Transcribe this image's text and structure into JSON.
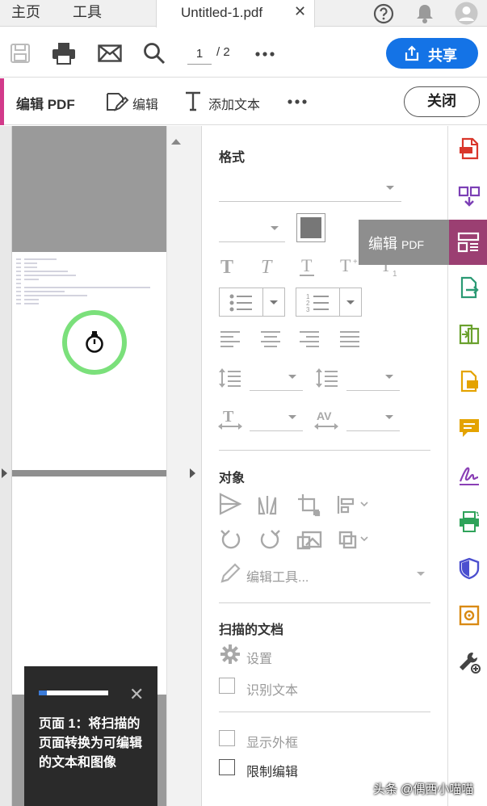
{
  "tabs": {
    "home": "主页",
    "tools": "工具",
    "document": "Untitled-1.pdf",
    "close_symbol": "✕"
  },
  "toolbar": {
    "page_current": "1",
    "page_total": "/ 2",
    "share_label": "共享"
  },
  "edit_bar": {
    "title": "编辑 PDF",
    "edit_label": "编辑",
    "add_text_label": "添加文本",
    "close_label": "关闭"
  },
  "props": {
    "format_title": "格式",
    "object_title": "对象",
    "edit_tools_label": "编辑工具...",
    "scan_title": "扫描的文档",
    "settings_label": "设置",
    "ocr_label": "识别文本",
    "show_bbox_label": "显示外框",
    "restrict_edit_label": "限制编辑",
    "color_swatch": "#777777"
  },
  "tooltip": {
    "main": "编辑",
    "suffix": "PDF"
  },
  "coach": {
    "text": "页面 1：将扫描的页面转换为可编辑的文本和图像",
    "progress": 0.12
  },
  "watermark": "头条 @偶西小喵喵",
  "colors": {
    "accent": "#1473e6",
    "edit_accent": "#d23a8a",
    "rail_active": "#9b3f72"
  }
}
